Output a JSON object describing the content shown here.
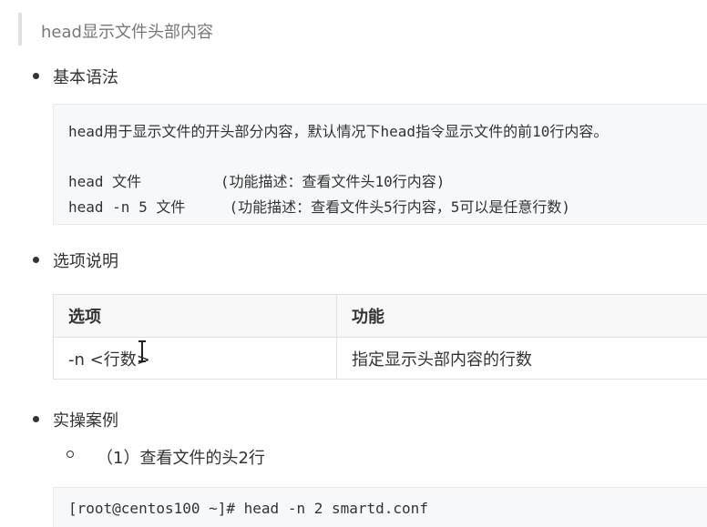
{
  "heading": "head显示文件头部内容",
  "sections": {
    "syntax": "基本语法",
    "options": "选项说明",
    "examples": "实操案例"
  },
  "syntax_block": {
    "line1": "head用于显示文件的开头部分内容，默认情况下head指令显示文件的前10行内容。",
    "line2": "head 文件         (功能描述：查看文件头10行内容)",
    "line3": "head -n 5 文件     (功能描述：查看文件头5行内容，5可以是任意行数)"
  },
  "options_table": {
    "headers": [
      "选项",
      "功能"
    ],
    "rows": [
      [
        "-n <行数>",
        "指定显示头部内容的行数"
      ]
    ]
  },
  "example1": {
    "title": "（1）查看文件的头2行",
    "command": "[root@centos100 ~]# head -n 2 smartd.conf"
  },
  "icons": {
    "cursor": "text-cursor-icon"
  }
}
